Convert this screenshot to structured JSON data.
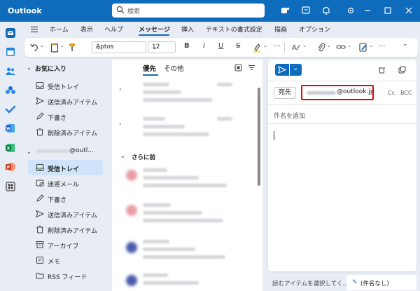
{
  "titlebar": {
    "app_name": "Outlook",
    "search_placeholder": "検索"
  },
  "ribbon": {
    "tabs": [
      "ホーム",
      "表示",
      "ヘルプ",
      "メッセージ",
      "挿入",
      "テキストの書式設定",
      "描画",
      "オプション"
    ],
    "active_tab": "メッセージ",
    "font_name": "Aptos",
    "font_size": "12",
    "more_label": "..."
  },
  "folders": {
    "favorites_label": "お気に入り",
    "favorites": [
      "受信トレイ",
      "送信済みアイテム",
      "下書き",
      "削除済みアイテム"
    ],
    "account_suffix": "@outl...",
    "account_folders": [
      "受信トレイ",
      "迷惑メール",
      "下書き",
      "送信済みアイテム",
      "削除済みアイテム",
      "アーカイブ",
      "メモ",
      "RSS フィード"
    ],
    "selected_folder": "受信トレイ"
  },
  "message_list": {
    "tabs": [
      "優先",
      "その他"
    ],
    "active_tab": "優先",
    "section_label": "さらに前"
  },
  "compose": {
    "to_label": "宛先",
    "recipient_suffix": "@outlook.jp",
    "cc_label": "Cc",
    "bcc_label": "BCC",
    "subject_placeholder": "件名を追加"
  },
  "status": {
    "reading_hint": "読むアイテムを選択してく...",
    "draft_label": "(件名なし)"
  },
  "colors": {
    "brand": "#0f6cbd",
    "highlight": "#e00000",
    "selected": "#cfe4fa"
  }
}
